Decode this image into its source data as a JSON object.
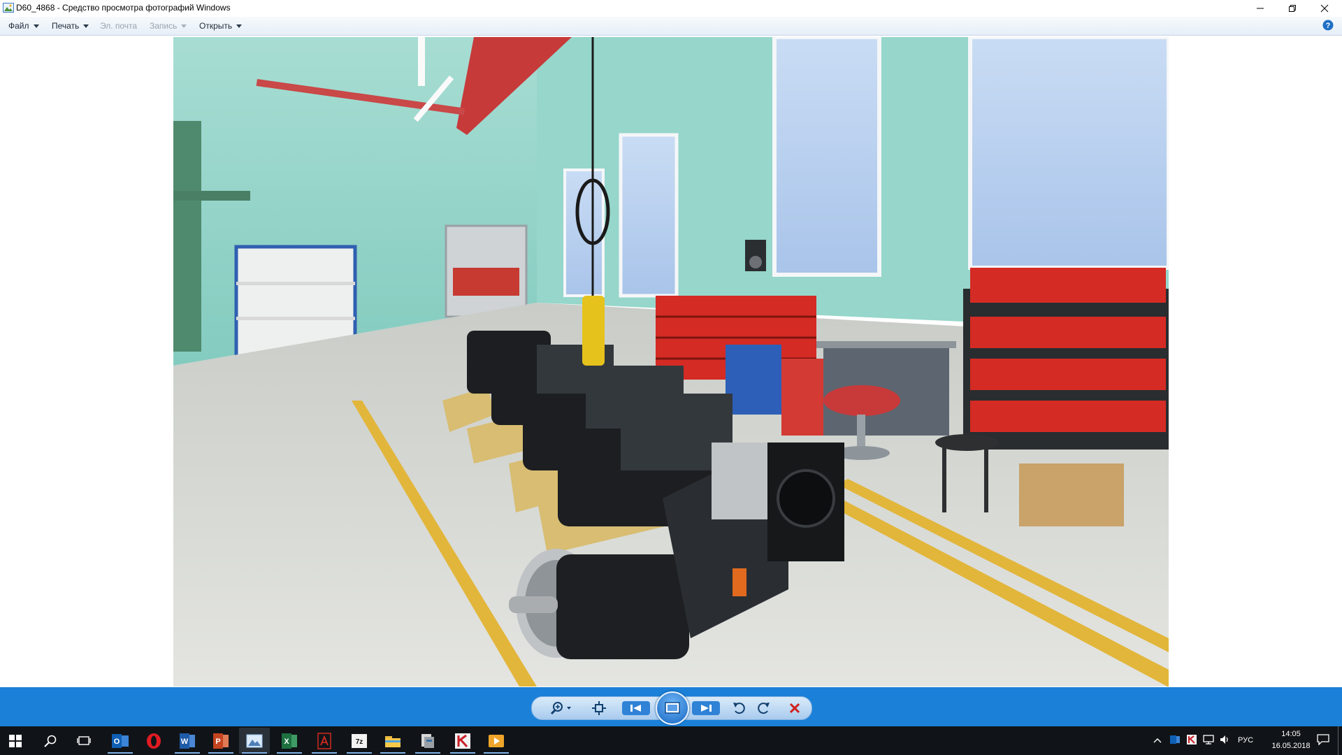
{
  "window": {
    "title": "D60_4868 - Средство просмотра фотографий Windows",
    "icon": "photo-viewer-icon",
    "controls": [
      "minimize-icon",
      "restore-icon",
      "close-icon"
    ]
  },
  "menu": {
    "file": "Файл",
    "print": "Печать",
    "email": "Эл. почта",
    "burn": "Запись",
    "open": "Открыть",
    "help_icon": "help-icon"
  },
  "photo": {
    "subject": "generator-assembly-workshop",
    "colors": {
      "wall": "#8fd4c8",
      "floor": "#d9dbd6",
      "stripe": "#e2b63a",
      "bins": "#d42b24",
      "shelf": "#2d63b8"
    }
  },
  "controls": {
    "items": [
      "zoom-icon",
      "actual-size-icon",
      "previous-icon",
      "slideshow-icon",
      "next-icon",
      "rotate-left-icon",
      "rotate-right-icon",
      "delete-icon"
    ],
    "accent": "#1b80d8"
  },
  "taskbar": {
    "apps": [
      "start-icon",
      "search-icon",
      "task-view-icon",
      "outlook-icon",
      "opera-icon",
      "word-icon",
      "powerpoint-icon",
      "photo-viewer-icon",
      "excel-icon",
      "acrobat-icon",
      "7zip-icon",
      "explorer-icon",
      "archive-icon",
      "kaspersky-icon",
      "media-player-icon"
    ],
    "language": "РУС",
    "time": "14:05",
    "date": "16.05.2018"
  }
}
